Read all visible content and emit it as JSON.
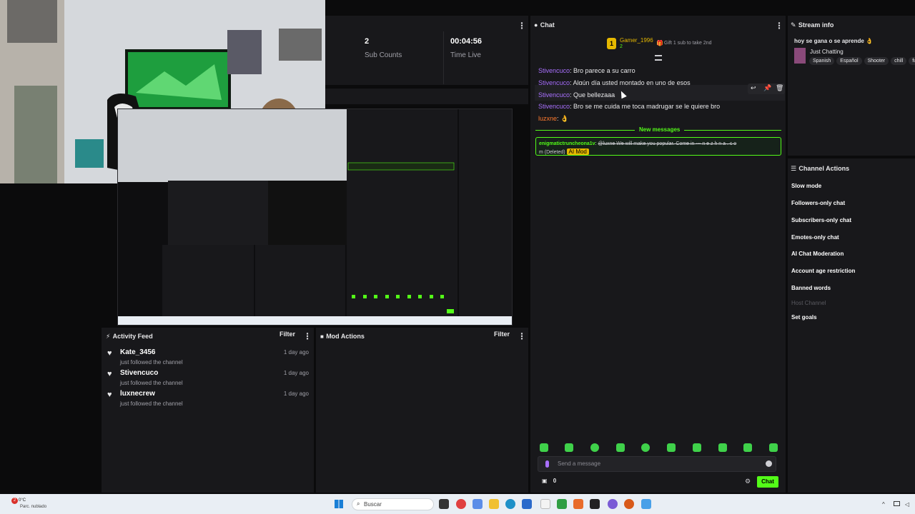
{
  "stats": [
    {
      "value": "2",
      "label": "Sub Counts"
    },
    {
      "value": "00:04:56",
      "label": "Time Live"
    }
  ],
  "chat": {
    "title": "Chat",
    "top_gifter": {
      "name": "Gamer_1996",
      "count": "2",
      "gift_text": "Gift 1 sub to take 2nd"
    },
    "messages": [
      {
        "user": "Stivencuco",
        "text": "Bro parece a su carro"
      },
      {
        "user": "Stivencuco",
        "text": "Algún día usted montado en uno de esos"
      },
      {
        "user": "Stivencuco",
        "text": "Que bellezaaa"
      },
      {
        "user": "Stivencuco",
        "text": "Bro se me cuida me toca madrugar se le quiere bro"
      },
      {
        "user": "luzxne",
        "text": "👌"
      }
    ],
    "new_messages_label": "New messages",
    "deleted": {
      "user": "enigmatictruncheona1v",
      "text": "@luxne We will make you popular. Come in --- n e z h n a . c o",
      "text2": "m (Deleted)",
      "badge": "AI Mod"
    },
    "input_placeholder": "Send a message",
    "points": "0",
    "send_label": "Chat"
  },
  "stream_info": {
    "title": "Stream info",
    "stream_title": "hoy se gana o se aprende 👌",
    "category": "Just Chatting",
    "tags": [
      "Spanish",
      "Español",
      "Shooter",
      "chill",
      "fu"
    ]
  },
  "channel_actions": {
    "title": "Channel Actions",
    "items": [
      {
        "label": "Slow mode",
        "disabled": false
      },
      {
        "label": "Followers-only chat",
        "disabled": false
      },
      {
        "label": "Subscribers-only chat",
        "disabled": false
      },
      {
        "label": "Emotes-only chat",
        "disabled": false
      },
      {
        "label": "AI Chat Moderation",
        "disabled": false
      },
      {
        "label": "Account age restriction",
        "disabled": false
      },
      {
        "label": "Banned words",
        "disabled": false
      },
      {
        "label": "Host Channel",
        "disabled": true
      },
      {
        "label": "Set goals",
        "disabled": false
      }
    ]
  },
  "activity_feed": {
    "title": "Activity Feed",
    "filter_label": "Filter",
    "items": [
      {
        "name": "Kate_3456",
        "sub": "just followed the channel",
        "time": "1 day ago"
      },
      {
        "name": "Stivencuco",
        "sub": "just followed the channel",
        "time": "1 day ago"
      },
      {
        "name": "luxnecrew",
        "sub": "just followed the channel",
        "time": "1 day ago"
      }
    ]
  },
  "mod_actions": {
    "title": "Mod Actions",
    "filter_label": "Filter"
  },
  "taskbar": {
    "weather_temp": "0°C",
    "weather_desc": "Parc. nublado",
    "weather_badge": "2",
    "search_label": "Buscar"
  },
  "colors": {
    "accent": "#53fc18",
    "purple": "#a970ff",
    "panel": "#18181b",
    "bg": "#0b0b0c"
  }
}
